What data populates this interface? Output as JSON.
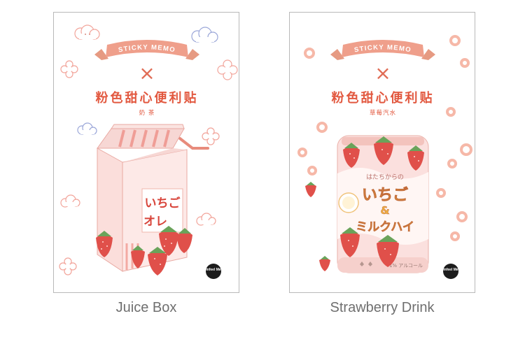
{
  "products": [
    {
      "ribbon": "STICKY MEMO",
      "cross": "×",
      "title": "粉色甜心便利贴",
      "subtitle": "奶 茶",
      "package_text_1": "いちご",
      "package_text_2": "オレ",
      "logo": "Infeel Me",
      "caption": "Juice Box"
    },
    {
      "ribbon": "STICKY MEMO",
      "cross": "×",
      "title": "粉色甜心便利贴",
      "subtitle": "草莓汽水",
      "can_text_small": "はたちからの",
      "can_text_1": "いちご",
      "can_text_amp": "&",
      "can_text_2": "ミルクハイ",
      "can_text_bottom": "1% アルコール",
      "logo": "Infeel Me",
      "caption": "Strawberry Drink"
    }
  ]
}
